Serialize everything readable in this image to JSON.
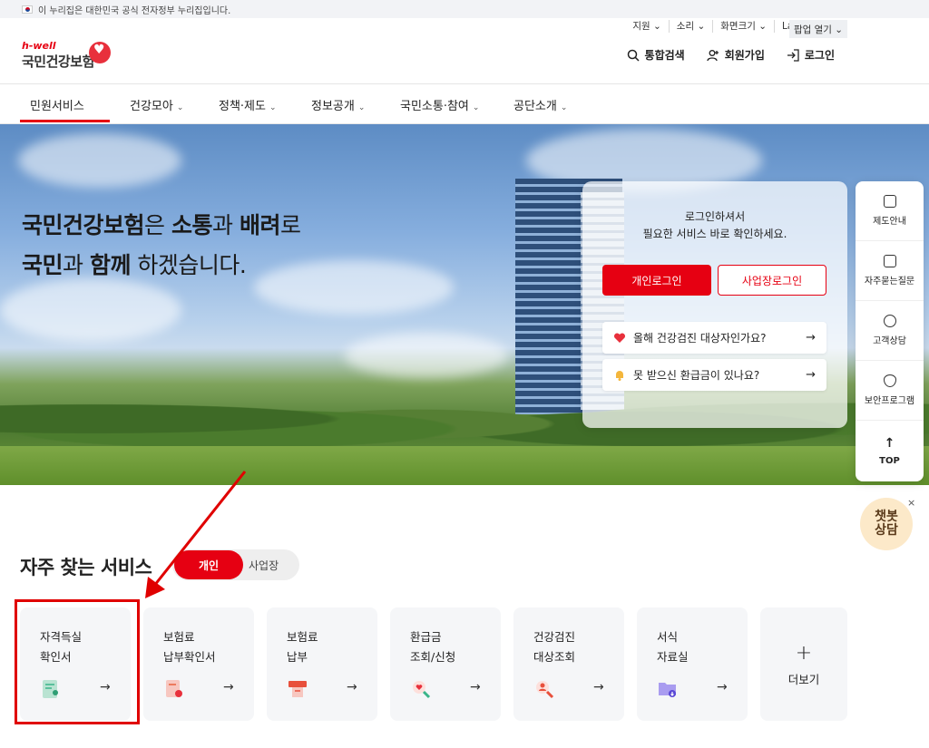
{
  "gov_banner": {
    "text": "이 누리집은 대한민국 공식 전자정부 누리집입니다."
  },
  "util_links": [
    "지원 ⌄",
    "소리 ⌄",
    "화면크기 ⌄",
    "Language ⌄"
  ],
  "popup_label": "팝업 열기 ⌄",
  "logo": {
    "top": "h-well",
    "name": "국민건강보험"
  },
  "header_actions": {
    "search": "통합검색",
    "signup": "회원가입",
    "login": "로그인"
  },
  "nav": [
    {
      "label": "민원서비스"
    },
    {
      "label": "건강모아"
    },
    {
      "label": "정책·제도"
    },
    {
      "label": "정보공개"
    },
    {
      "label": "국민소통·참여"
    },
    {
      "label": "공단소개"
    }
  ],
  "hero": {
    "line1_a": "국민건강보험",
    "line1_b": "은 ",
    "line1_c": "소통",
    "line1_d": "과 ",
    "line1_e": "배려",
    "line1_f": "로",
    "line2_a": "국민",
    "line2_b": "과 ",
    "line2_c": "함께",
    "line2_d": " 하겠습니다."
  },
  "login_card": {
    "msg1": "로그인하셔서",
    "msg2": "필요한 서비스 바로 확인하세요.",
    "btn_individual": "개인로그인",
    "btn_business": "사업장로그인",
    "link1": "올해 건강검진 대상자인가요?",
    "link2": "못 받으신 환급금이 있나요?"
  },
  "quick_menu": [
    "제도안내",
    "자주묻는질문",
    "고객상담",
    "보안프로그램",
    "TOP"
  ],
  "chatbot": {
    "line1": "챗봇",
    "line2": "상담",
    "close": "×"
  },
  "services": {
    "title": "자주 찾는 서비스",
    "toggle_on": "개인",
    "toggle_off": "사업장",
    "cards": [
      {
        "l1": "자격득실",
        "l2": "확인서"
      },
      {
        "l1": "보험료",
        "l2": "납부확인서"
      },
      {
        "l1": "보험료",
        "l2": "납부"
      },
      {
        "l1": "환급금",
        "l2": "조회/신청"
      },
      {
        "l1": "건강검진",
        "l2": "대상조회"
      },
      {
        "l1": "서식",
        "l2": "자료실"
      }
    ],
    "more": "더보기"
  },
  "arrow_glyph": "→",
  "colors": {
    "brand_red": "#e60012",
    "annotation_red": "#e00000"
  }
}
